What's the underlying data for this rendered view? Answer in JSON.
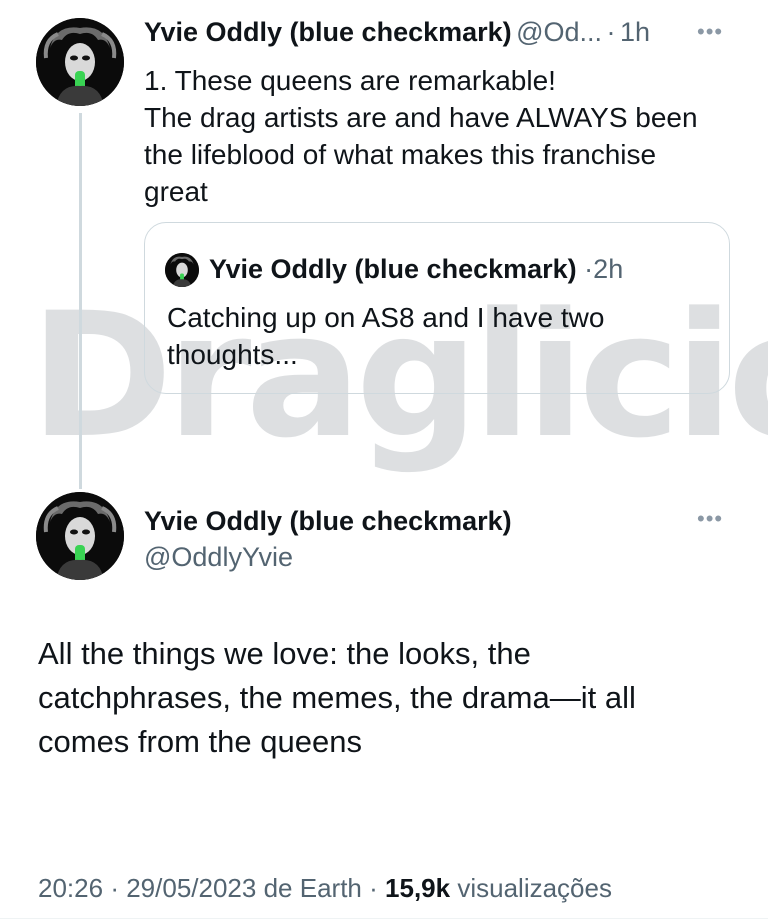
{
  "reply_tweet": {
    "author_name": "Yvie Oddly (blue checkmark)",
    "handle_truncated": "@Od...",
    "separator": "·",
    "time": "1h",
    "more_icon": "more-horizontal-icon",
    "text_lines": [
      "1. These queens are remarkable!",
      "The drag artists are and have ALWAYS been",
      "the lifeblood of what makes this franchise",
      "great"
    ]
  },
  "quoted_tweet": {
    "author_name": "Yvie Oddly (blue checkmark)",
    "separator": "·",
    "time": "2h",
    "text_lines": [
      "Catching up on AS8 and I have two",
      "thoughts..."
    ]
  },
  "watermark": {
    "text": "Draglicious"
  },
  "main_tweet": {
    "author_name": "Yvie Oddly (blue checkmark)",
    "handle": "@OddlyYvie",
    "more_icon": "more-horizontal-icon",
    "text_lines": [
      "All the things we love: the looks, the",
      "catchphrases, the memes, the drama—it all",
      "comes from the queens"
    ],
    "meta": {
      "time": "20:26",
      "sep1": "·",
      "date": "29/05/2023",
      "source": "de Earth",
      "sep2": "·",
      "views_count": "15,9k",
      "views_label": "visualizações"
    }
  },
  "colors": {
    "text": "#0f1419",
    "muted": "#536471",
    "border": "#cfd9de",
    "avatar_accent": "#39d353"
  }
}
